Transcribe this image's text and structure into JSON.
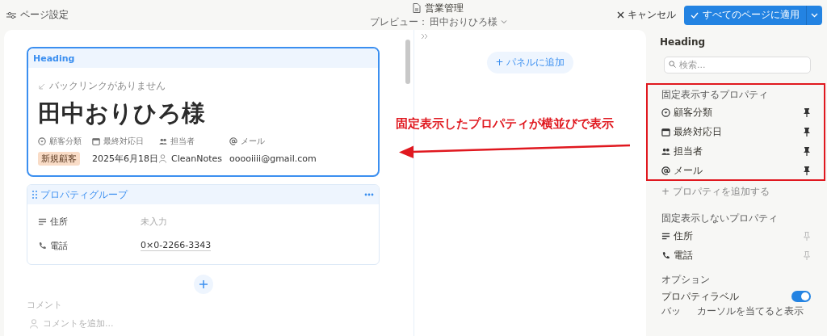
{
  "toolbar": {
    "page_settings": "ページ設定",
    "doc_title": "営業管理",
    "preview_label": "プレビュー：",
    "preview_value": "田中おりひろ様",
    "cancel": "キャンセル",
    "apply": "すべてのページに適用"
  },
  "preview": {
    "heading_label": "Heading",
    "backlinks": "バックリンクがありません",
    "title": "田中おりひろ様",
    "pinned": [
      {
        "name": "顧客分類",
        "kind": "select",
        "value": "新規顧客"
      },
      {
        "name": "最終対応日",
        "kind": "date",
        "value": "2025年6月18日"
      },
      {
        "name": "担当者",
        "kind": "person",
        "value": "CleanNotes"
      },
      {
        "name": "メール",
        "kind": "email",
        "value": "ooooiiii@gmail.com"
      }
    ],
    "group": {
      "title": "プロパティグループ",
      "rows": [
        {
          "name": "住所",
          "kind": "text",
          "value": "未入力",
          "empty": true
        },
        {
          "name": "電話",
          "kind": "phone",
          "value": "0×0-2266-3343",
          "empty": false
        }
      ]
    },
    "comments": {
      "label": "コメント",
      "placeholder": "コメントを追加..."
    }
  },
  "panel": {
    "add_button": "+ パネルに追加"
  },
  "sidebar": {
    "title": "Heading",
    "search_placeholder": "検索...",
    "pinned_label": "固定表示するプロパティ",
    "pinned": [
      {
        "name": "顧客分類",
        "kind": "select",
        "pinned": true
      },
      {
        "name": "最終対応日",
        "kind": "date",
        "pinned": true
      },
      {
        "name": "担当者",
        "kind": "person",
        "pinned": true
      },
      {
        "name": "メール",
        "kind": "email",
        "pinned": true
      }
    ],
    "add_property": "+ プロパティを追加する",
    "unpinned_label": "固定表示しないプロパティ",
    "unpinned": [
      {
        "name": "住所",
        "kind": "text",
        "pinned": false
      },
      {
        "name": "電話",
        "kind": "phone",
        "pinned": false
      }
    ],
    "options_label": "オプション",
    "toggle": {
      "label": "プロパティラベル",
      "on": true
    },
    "last_row": {
      "label": "バッ",
      "value": "カーソルを当てると表示"
    }
  },
  "annotation": {
    "text": "固定表示したプロパティが横並びで表示"
  }
}
